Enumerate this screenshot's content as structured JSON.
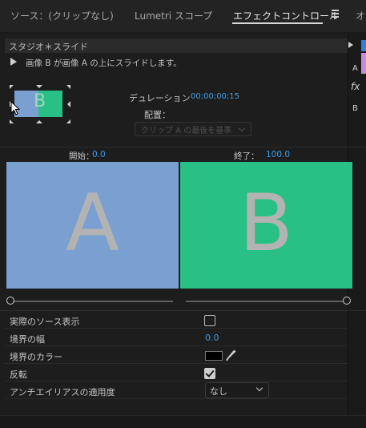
{
  "tabs": [
    {
      "label": "ソース：(クリップなし)"
    },
    {
      "label": "Lumetri スコープ"
    },
    {
      "label": "エフェクトコントロール"
    },
    {
      "label": "オ"
    }
  ],
  "effect": {
    "title": "スタジオ＊スライド",
    "description": "画像 B が画像 A の上にスライドします。",
    "duration_label": "デュレーション",
    "duration_value": "00;00;00;15",
    "placement_label": "配置：",
    "placement_value": "クリップ A の最後を基準",
    "thumb_letter": "B"
  },
  "preview": {
    "start_label": "開始：",
    "start_value": "0.0",
    "end_label": "終了：",
    "end_value": "100.0",
    "a_letter": "A",
    "b_letter": "B",
    "a_color": "#7a9fd1",
    "b_color": "#29c086"
  },
  "properties": {
    "show_actual_sources_label": "実際のソース表示",
    "show_actual_sources_checked": false,
    "border_width_label": "境界の幅",
    "border_width_value": "0.0",
    "border_color_label": "境界のカラー",
    "border_color_value": "#000000",
    "reverse_label": "反転",
    "reverse_checked": true,
    "antialias_label": "アンチエイリアスの適用度",
    "antialias_value": "なし"
  },
  "right_strip": {
    "a_label": "A",
    "fx_label": "fx",
    "b_label": "B"
  },
  "colors": {
    "accent_blue": "#3f9be8"
  }
}
